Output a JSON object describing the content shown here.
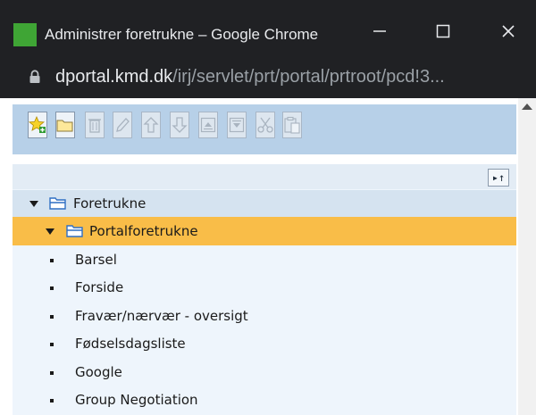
{
  "window": {
    "title": "Administrer foretrukne – Google Chrome",
    "minimize_glyph": "—",
    "maximize_glyph": "☐",
    "close_glyph": "✕"
  },
  "address_bar": {
    "host": "dportal.kmd.dk",
    "path": "/irj/servlet/prt/portal/prtroot/pcd!3..."
  },
  "toolbar": {
    "buttons": [
      {
        "icon": "new-favorite-icon"
      },
      {
        "icon": "folder-icon"
      },
      {
        "icon": "delete-icon"
      },
      {
        "icon": "edit-icon"
      },
      {
        "icon": "move-up-icon"
      },
      {
        "icon": "move-down-icon"
      },
      {
        "icon": "move-top-icon"
      },
      {
        "icon": "move-bottom-icon"
      },
      {
        "icon": "cut-icon"
      },
      {
        "icon": "paste-icon"
      }
    ]
  },
  "tree": {
    "collapse_all_glyph": "▸↑",
    "root": {
      "label": "Foretrukne"
    },
    "selected": {
      "label": "Portalforetrukne"
    },
    "items": [
      {
        "label": "Barsel"
      },
      {
        "label": "Forside"
      },
      {
        "label": "Fravær/nærvær - oversigt"
      },
      {
        "label": "Fødselsdagsliste"
      },
      {
        "label": "Google"
      },
      {
        "label": "Group Negotiation"
      }
    ]
  },
  "colors": {
    "titlebar_bg": "#202124",
    "toolbar_panel": "#b7d0e8",
    "tree_bg": "#eef5fc",
    "selected_row": "#f9bd48",
    "folder_blue": "#2f6fc4"
  }
}
